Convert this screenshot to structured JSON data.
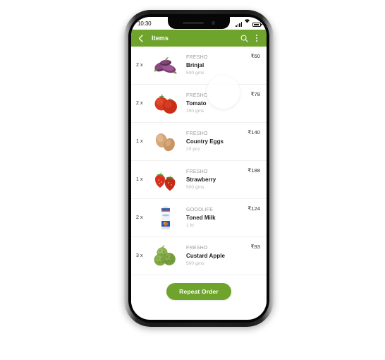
{
  "device": {
    "notch_speaker_icon": "speaker-grille-icon",
    "notch_camera_icon": "front-camera-icon"
  },
  "status_bar": {
    "time": "10:30",
    "signal_icon": "cellular-signal-icon",
    "wifi_icon": "wifi-icon",
    "battery_icon": "battery-icon"
  },
  "app_bar": {
    "back_icon": "back-chevron-icon",
    "title": "Items",
    "search_icon": "search-icon",
    "overflow_icon": "more-vertical-icon"
  },
  "items": [
    {
      "qty": "2 x",
      "brand": "FRESHO",
      "name": "Brinjal",
      "unit": "500 gms",
      "price": "₹60",
      "thumb": "brinjal-image"
    },
    {
      "qty": "2 x",
      "brand": "FRESHO",
      "name": "Tomato",
      "unit": "250 gms",
      "price": "₹78",
      "thumb": "tomato-image"
    },
    {
      "qty": "1 x",
      "brand": "FRESHO",
      "name": "Country Eggs",
      "unit": "20 pcs",
      "price": "₹140",
      "thumb": "eggs-image"
    },
    {
      "qty": "1 x",
      "brand": "FRESHO",
      "name": "Strawberry",
      "unit": "500 gms",
      "price": "₹188",
      "thumb": "strawberry-image"
    },
    {
      "qty": "2 x",
      "brand": "GOODLIFE",
      "name": "Toned Milk",
      "unit": "1 ltr",
      "price": "₹124",
      "thumb": "milk-carton-image"
    },
    {
      "qty": "3 x",
      "brand": "FRESHO",
      "name": "Custard Apple",
      "unit": "500 gms",
      "price": "₹93",
      "thumb": "custard-apple-image"
    }
  ],
  "footer": {
    "repeat_order_label": "Repeat Order"
  },
  "colors": {
    "brand_green": "#6fa42c",
    "text_primary": "#1b1b1b",
    "text_muted": "#9b9b9b",
    "divider": "#f0f0f0"
  },
  "overlay": {
    "touch_indicator": "touch-cursor-indicator"
  }
}
